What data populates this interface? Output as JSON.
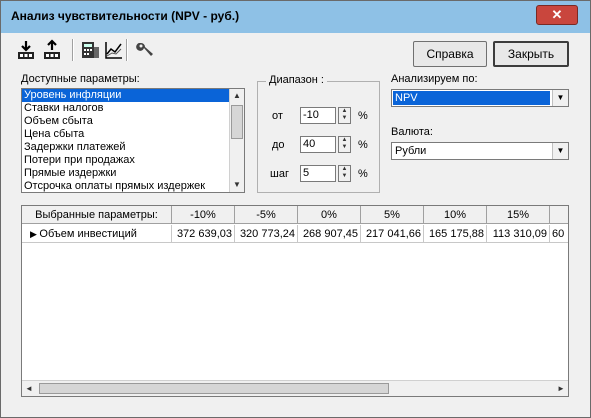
{
  "window": {
    "title": "Анализ чувствительности (NPV - руб.)",
    "close_glyph": "✕"
  },
  "toolbar": {
    "icons": [
      "import-icon",
      "export-icon",
      "calculator-icon",
      "chart-icon",
      "tools-icon"
    ],
    "help_label": "Справка",
    "close_label": "Закрыть"
  },
  "params": {
    "label": "Доступные параметры:",
    "items": [
      "Уровень инфляции",
      "Ставки налогов",
      "Объем сбыта",
      "Цена сбыта",
      "Задержки платежей",
      "Потери при продажах",
      "Прямые издержки",
      "Отсрочка оплаты прямых издержек"
    ],
    "selected_index": 0
  },
  "range": {
    "title": "Диапазон :",
    "from_label": "от",
    "from_value": "-10",
    "to_label": "до",
    "to_value": "40",
    "step_label": "шаг",
    "step_value": "5",
    "unit": "%"
  },
  "analyze": {
    "label": "Анализируем по:",
    "value": "NPV"
  },
  "currency": {
    "label": "Валюта:",
    "value": "Рубли"
  },
  "grid": {
    "header_first": "Выбранные параметры:",
    "columns": [
      "-10%",
      "-5%",
      "0%",
      "5%",
      "10%",
      "15%"
    ],
    "rows": [
      {
        "name": "Объем инвестиций",
        "values": [
          "372 639,03",
          "320 773,24",
          "268 907,45",
          "217 041,66",
          "165 175,88",
          "113 310,09",
          "60"
        ]
      }
    ]
  },
  "colors": {
    "selection": "#0a64d8",
    "titlebar": "#8ec1e6",
    "close": "#c9463d"
  }
}
